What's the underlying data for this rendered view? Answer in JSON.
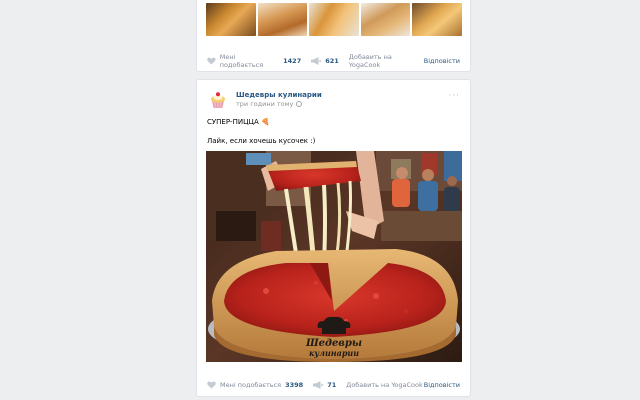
{
  "top_post": {
    "thumbnails": [
      "croissants-photo-1",
      "croissants-photo-2",
      "croissants-photo-3",
      "croissants-photo-4",
      "croissants-photo-5"
    ],
    "likes_label": "Мені подобається",
    "likes_count": "1427",
    "shares_count": "621",
    "add_label": "Добавить на YogaCook",
    "reply_label": "Відповісти"
  },
  "post": {
    "author": "Шедевры кулинарии",
    "time": "три години тому",
    "text_line1": "СУПЕР-ПИЦЦА 🍕",
    "text_line2": "Лайк, если хочешь кусочек :)",
    "photo_alt": "deep-dish-pizza-photo",
    "watermark_line1": "Шедевры",
    "watermark_line2": "кулинарии",
    "likes_label": "Мені подобається",
    "likes_count": "3398",
    "shares_count": "71",
    "add_label": "Добавить на YogaCook",
    "reply_label": "Відповісти",
    "more": "···"
  },
  "colors": {
    "page_bg": "#edeef0",
    "link": "#2a5885",
    "muted": "#828a99",
    "card_border": "#dfe2e8"
  },
  "icons": [
    "heart-icon",
    "megaphone-icon",
    "eye-icon",
    "more-icon",
    "avatar-cupcake-icon"
  ]
}
